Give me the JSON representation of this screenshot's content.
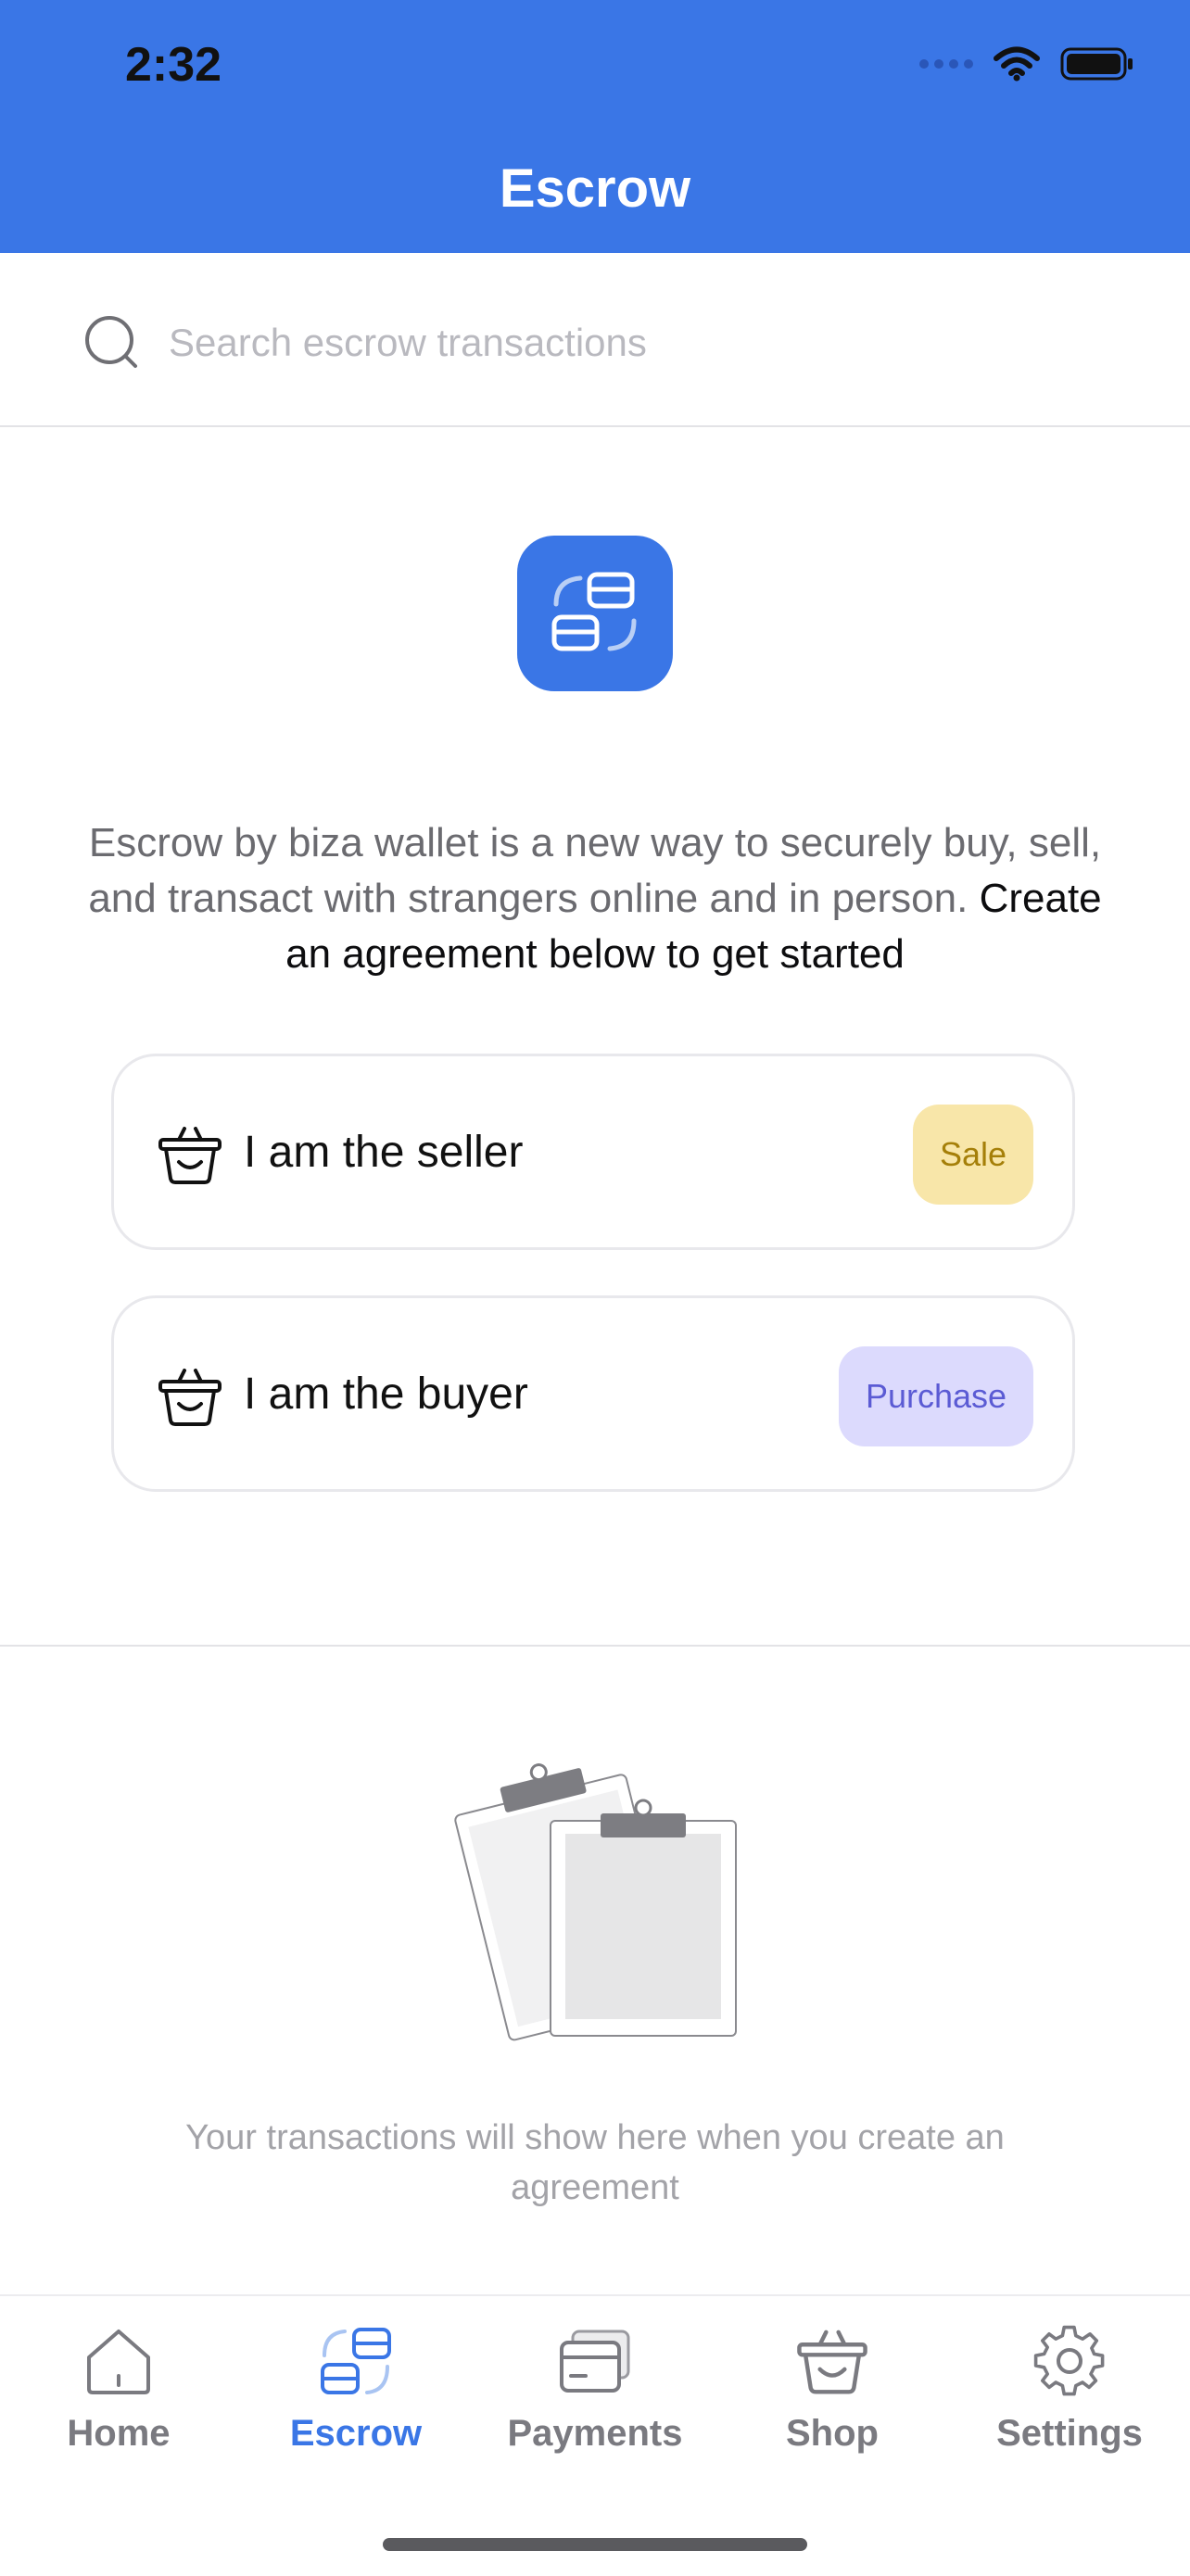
{
  "status_bar": {
    "time": "2:32"
  },
  "header": {
    "title": "Escrow"
  },
  "search": {
    "placeholder": "Search escrow transactions",
    "value": ""
  },
  "intro": {
    "text": "Escrow by biza wallet is a new way to securely buy, sell, and transact with strangers online and in person.",
    "cta": "Create an agreement below to get started"
  },
  "roles": [
    {
      "label": "I am the seller",
      "badge": "Sale",
      "badge_color": "#f8e6a9",
      "badge_text_color": "#a57f09",
      "icon": "basket-icon"
    },
    {
      "label": "I am the buyer",
      "badge": "Purchase",
      "badge_color": "#dcdafd",
      "badge_text_color": "#5b5bd4",
      "icon": "basket-icon"
    }
  ],
  "empty_state": {
    "text": "Your transactions will show here when you create an agreement",
    "icon": "clipboards-illustration"
  },
  "tabbar": {
    "active": "Escrow",
    "accent_color": "#3a76e6",
    "items": [
      {
        "label": "Home",
        "icon": "home-icon"
      },
      {
        "label": "Escrow",
        "icon": "escrow-icon"
      },
      {
        "label": "Payments",
        "icon": "card-icon"
      },
      {
        "label": "Shop",
        "icon": "basket-icon"
      },
      {
        "label": "Settings",
        "icon": "gear-icon"
      }
    ]
  },
  "colors": {
    "primary": "#3a76e6",
    "background": "#ffffff"
  }
}
